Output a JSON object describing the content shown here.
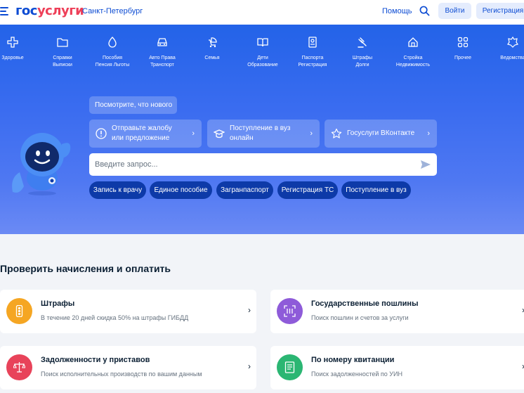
{
  "header": {
    "logo_left": "гос",
    "logo_right": "услуги",
    "city": "Санкт-Петербург",
    "help": "Помощь",
    "login": "Войти",
    "register": "Регистрация"
  },
  "categories": [
    {
      "label": "Здоровье",
      "icon": "health-icon"
    },
    {
      "label": "Справки\nВыписки",
      "icon": "folder-icon"
    },
    {
      "label": "Пособия\nПенсия Льготы",
      "icon": "benefits-icon"
    },
    {
      "label": "Авто Права\nТранспорт",
      "icon": "car-icon"
    },
    {
      "label": "Семья",
      "icon": "stroller-icon"
    },
    {
      "label": "Дети\nОбразование",
      "icon": "book-icon"
    },
    {
      "label": "Паспорта\nРегистрация",
      "icon": "passport-icon"
    },
    {
      "label": "Штрафы\nДолги",
      "icon": "gavel-icon"
    },
    {
      "label": "Стройка\nНедвижимость",
      "icon": "house-icon"
    },
    {
      "label": "Прочее",
      "icon": "grid-icon"
    },
    {
      "label": "Ведомства",
      "icon": "emblem-icon"
    }
  ],
  "hero": {
    "whats_new": "Посмотрите, что нового",
    "cards": [
      {
        "label": "Отправьте жалобу\nили предложение",
        "icon": "exclamation-icon"
      },
      {
        "label": "Поступление в вуз\nонлайн",
        "icon": "graduation-cap-icon"
      },
      {
        "label": "Госуслуги ВКонтакте",
        "icon": "star-icon"
      }
    ],
    "search_placeholder": "Введите запрос...",
    "quick": [
      "Запись к врачу",
      "Единое пособие",
      "Загранпаспорт",
      "Регистрация ТС",
      "Поступление в вуз"
    ]
  },
  "payments": {
    "title": "Проверить начисления и оплатить",
    "items": [
      {
        "title": "Штрафы",
        "subtitle": "В течение 20 дней скидка 50% на штрафы ГИБДД",
        "color": "#f5a623",
        "icon": "traffic-light-icon"
      },
      {
        "title": "Государственные пошлины",
        "subtitle": "Поиск пошлин и счетов за услуги",
        "color": "#8e5bd9",
        "icon": "receipt-scan-icon"
      },
      {
        "title": "Задолженности у приставов",
        "subtitle": "Поиск исполнительных производств по вашим данным",
        "color": "#e8435a",
        "icon": "scales-icon"
      },
      {
        "title": "По номеру квитанции",
        "subtitle": "Поиск задолженностей по УИН",
        "color": "#2bb673",
        "icon": "document-icon"
      }
    ]
  },
  "colors": {
    "brand_blue": "#0d4cd3",
    "brand_red": "#ee3f58",
    "hero_blue": "#2363e8"
  }
}
